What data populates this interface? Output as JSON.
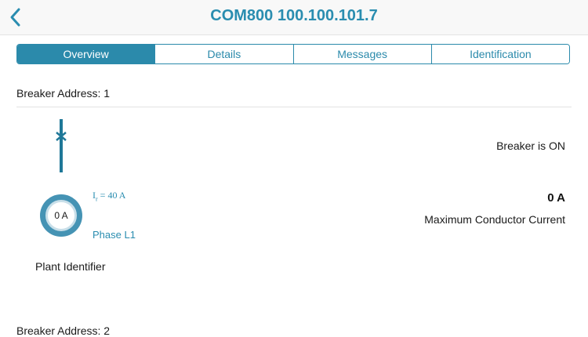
{
  "header": {
    "title": "COM800 100.100.101.7"
  },
  "tabs": [
    {
      "label": "Overview",
      "active": true
    },
    {
      "label": "Details",
      "active": false
    },
    {
      "label": "Messages",
      "active": false
    },
    {
      "label": "Identification",
      "active": false
    }
  ],
  "breaker": {
    "address_label": "Breaker Address: 1",
    "status": "Breaker is ON",
    "gauge_value": "0 A",
    "rated_current_symbol": "I",
    "rated_current_subscript": "r",
    "rated_current_value": " = 40 A",
    "phase": "Phase L1",
    "max_current_value": "0 A",
    "max_current_label": "Maximum Conductor Current",
    "plant_identifier_label": "Plant Identifier"
  },
  "next_section": {
    "address_label": "Breaker Address: 2"
  },
  "colors": {
    "accent": "#2b8aab",
    "title": "#2a8db0",
    "gauge_ring": "#4593b4"
  },
  "icons": {
    "back": "chevron-left-icon",
    "breaker": "breaker-switch-icon"
  }
}
